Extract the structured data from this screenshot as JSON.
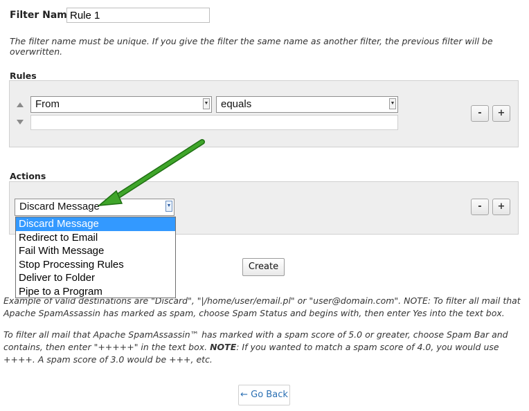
{
  "filter_name": {
    "label": "Filter Name:",
    "value": "Rule 1",
    "note": "The filter name must be unique. If you give the filter the same name as another filter, the previous filter will be overwritten."
  },
  "rules": {
    "title": "Rules",
    "field_select": "From",
    "operator_select": "equals",
    "value": "",
    "remove_label": "-",
    "add_label": "+"
  },
  "actions": {
    "title": "Actions",
    "selected": "Discard Message",
    "remove_label": "-",
    "add_label": "+",
    "options": [
      "Discard Message",
      "Redirect to Email",
      "Fail With Message",
      "Stop Processing Rules",
      "Deliver to Folder",
      "Pipe to a Program"
    ]
  },
  "create_label": "Create",
  "notes": {
    "example": "Example of valid destinations are \"Discard\", \"|/home/user/email.pl\" or \"user@domain.com\". NOTE: To filter all mail that Apache SpamAssassin has marked as spam, choose Spam Status and begins with, then enter Yes into the text box.",
    "spam_part1": "To filter all mail that Apache SpamAssassin™ has marked with a spam score of 5.0 or greater, choose Spam Bar and contains, then enter \"+++++\" in the text box. ",
    "spam_note_word": "NOTE",
    "spam_part2": ": If you wanted to match a spam score of 4.0, you would use ++++. A spam score of 3.0 would be +++, etc."
  },
  "back_label": "← Go Back",
  "colors": {
    "arrow": "#2e8b1f",
    "highlight": "#3399ff",
    "panel": "#eeeeee"
  }
}
